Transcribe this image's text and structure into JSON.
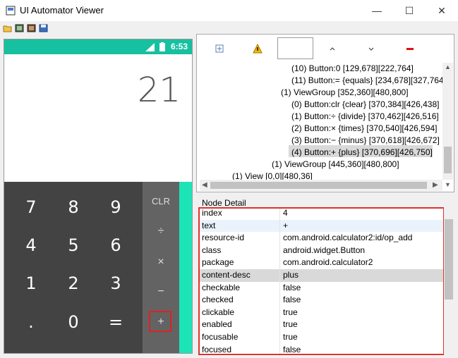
{
  "window": {
    "title": "UI Automator Viewer",
    "controls": [
      "—",
      "☐",
      "✕"
    ]
  },
  "device": {
    "clock": "6:53",
    "display": "21",
    "keys": [
      [
        "7",
        "8",
        "9"
      ],
      [
        "4",
        "5",
        "6"
      ],
      [
        "1",
        "2",
        "3"
      ],
      [
        ".",
        "0",
        "="
      ]
    ],
    "ops": [
      "CLR",
      "÷",
      "×",
      "−",
      "+"
    ]
  },
  "tree": [
    {
      "indent": 130,
      "text": "(10) Button:0 [129,678][222,764]"
    },
    {
      "indent": 130,
      "text": "(11) Button:= {equals} [234,678][327,764]"
    },
    {
      "indent": 115,
      "text": "(1) ViewGroup [352,360][480,800]"
    },
    {
      "indent": 130,
      "text": "(0) Button:clr {clear} [370,384][426,438]"
    },
    {
      "indent": 130,
      "text": "(1) Button:÷ {divide} [370,462][426,516]"
    },
    {
      "indent": 130,
      "text": "(2) Button:× {times} [370,540][426,594]"
    },
    {
      "indent": 130,
      "text": "(3) Button:− {minus} [370,618][426,672]"
    },
    {
      "indent": 130,
      "text": "(4) Button:+ {plus} [370,696][426,750]"
    },
    {
      "indent": 102,
      "text": "(1) ViewGroup [445,360][480,800]"
    },
    {
      "indent": 46,
      "text": "(1) View [0,0][480,36]"
    }
  ],
  "node_detail": {
    "label": "Node Detail",
    "rows": [
      {
        "key": "index",
        "value": "4"
      },
      {
        "key": "text",
        "value": "+"
      },
      {
        "key": "resource-id",
        "value": "com.android.calculator2:id/op_add"
      },
      {
        "key": "class",
        "value": "android.widget.Button"
      },
      {
        "key": "package",
        "value": "com.android.calculator2"
      },
      {
        "key": "content-desc",
        "value": "plus"
      },
      {
        "key": "checkable",
        "value": "false"
      },
      {
        "key": "checked",
        "value": "false"
      },
      {
        "key": "clickable",
        "value": "true"
      },
      {
        "key": "enabled",
        "value": "true"
      },
      {
        "key": "focusable",
        "value": "true"
      },
      {
        "key": "focused",
        "value": "false"
      }
    ]
  },
  "colors": {
    "accent_teal": "#1de4b7",
    "status_bar": "#16c0a0",
    "highlight_red": "#e03030",
    "keypad": "#434343"
  }
}
